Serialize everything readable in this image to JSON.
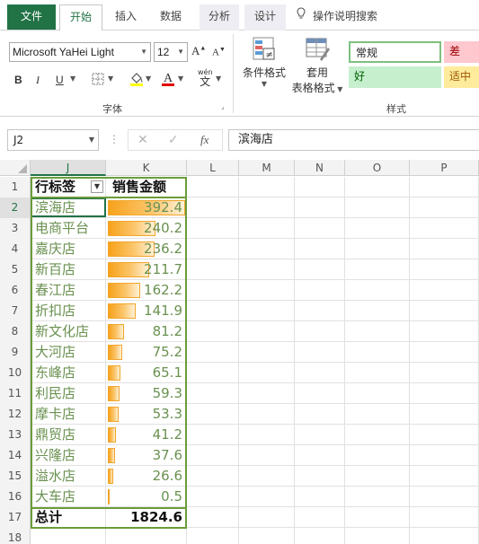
{
  "tabs": {
    "file": "文件",
    "home": "开始",
    "insert": "插入",
    "data": "数据",
    "analyze": "分析",
    "design": "设计",
    "tellme": "操作说明搜索"
  },
  "ribbon": {
    "font_name": "Microsoft YaHei Light",
    "font_size": "12",
    "grow_font": "A",
    "shrink_font": "A",
    "bold": "B",
    "italic": "I",
    "underline": "U",
    "wen": "wén",
    "wen_char": "文",
    "font_group": "字体",
    "cond_format_line1": "条件格式",
    "table_format_line1": "套用",
    "table_format_line2": "表格格式",
    "style_group": "样式",
    "style_normal": "常规",
    "style_bad": "差",
    "style_good": "好",
    "style_neutral": "适中"
  },
  "formula_bar": {
    "name_box": "J2",
    "fx": "fx",
    "content": "滨海店"
  },
  "columns": [
    "J",
    "K",
    "L",
    "M",
    "N",
    "O",
    "P"
  ],
  "pivot": {
    "header_label": "行标签",
    "header_value": "销售金额",
    "rows": [
      {
        "label": "滨海店",
        "value": "392.4",
        "amount": 392.4
      },
      {
        "label": "电商平台",
        "value": "240.2",
        "amount": 240.2
      },
      {
        "label": "嘉庆店",
        "value": "236.2",
        "amount": 236.2
      },
      {
        "label": "新百店",
        "value": "211.7",
        "amount": 211.7
      },
      {
        "label": "春江店",
        "value": "162.2",
        "amount": 162.2
      },
      {
        "label": "折扣店",
        "value": "141.9",
        "amount": 141.9
      },
      {
        "label": "新文化店",
        "value": "81.2",
        "amount": 81.2
      },
      {
        "label": "大河店",
        "value": "75.2",
        "amount": 75.2
      },
      {
        "label": "东峰店",
        "value": "65.1",
        "amount": 65.1
      },
      {
        "label": "利民店",
        "value": "59.3",
        "amount": 59.3
      },
      {
        "label": "摩卡店",
        "value": "53.3",
        "amount": 53.3
      },
      {
        "label": "鼎贸店",
        "value": "41.2",
        "amount": 41.2
      },
      {
        "label": "兴隆店",
        "value": "37.6",
        "amount": 37.6
      },
      {
        "label": "溢水店",
        "value": "26.6",
        "amount": 26.6
      },
      {
        "label": "大车店",
        "value": "0.5",
        "amount": 0.5
      }
    ],
    "total_label": "总计",
    "total_value": "1824.6"
  },
  "row_numbers": [
    "1",
    "2",
    "3",
    "4",
    "5",
    "6",
    "7",
    "8",
    "9",
    "10",
    "11",
    "12",
    "13",
    "14",
    "15",
    "16",
    "17",
    "18"
  ],
  "colors": {
    "accent": "#217346",
    "pivot_text": "#6a9150",
    "bar": "#f7a21b",
    "style_normal_border": "#7fbf7f",
    "style_bad_bg": "#ffc7ce",
    "style_good_bg": "#c6efce",
    "style_neutral_bg": "#ffeb9c"
  }
}
